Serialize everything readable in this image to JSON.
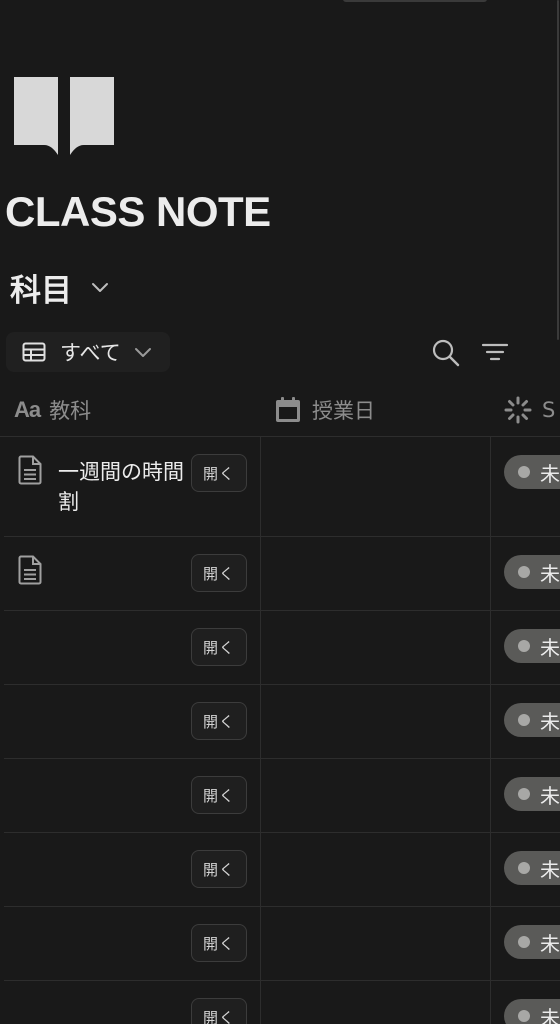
{
  "page": {
    "title": "CLASS NOTE",
    "icon": "book-open-icon"
  },
  "database": {
    "title": "科目",
    "view": {
      "label": "すべて",
      "icon": "table-icon"
    },
    "toolbar": {
      "search_icon": "search-icon",
      "filter_icon": "filter-icon"
    },
    "columns": [
      {
        "label": "教科",
        "icon": "title-aa-icon"
      },
      {
        "label": "授業日",
        "icon": "calendar-icon"
      },
      {
        "label": "S",
        "icon": "status-spinner-icon"
      }
    ],
    "open_label": "開く",
    "rows": [
      {
        "title": "一週間の時間割",
        "has_doc_icon": true,
        "status": "未"
      },
      {
        "title": "",
        "has_doc_icon": true,
        "status": "未"
      },
      {
        "title": "",
        "has_doc_icon": false,
        "status": "未"
      },
      {
        "title": "",
        "has_doc_icon": false,
        "status": "未"
      },
      {
        "title": "",
        "has_doc_icon": false,
        "status": "未"
      },
      {
        "title": "",
        "has_doc_icon": false,
        "status": "未"
      },
      {
        "title": "",
        "has_doc_icon": false,
        "status": "未"
      },
      {
        "title": "",
        "has_doc_icon": false,
        "status": "未"
      }
    ]
  },
  "colors": {
    "background": "#191919",
    "text": "#ececec",
    "muted": "#8c8c8c",
    "status_pill": "#5a5a58"
  }
}
